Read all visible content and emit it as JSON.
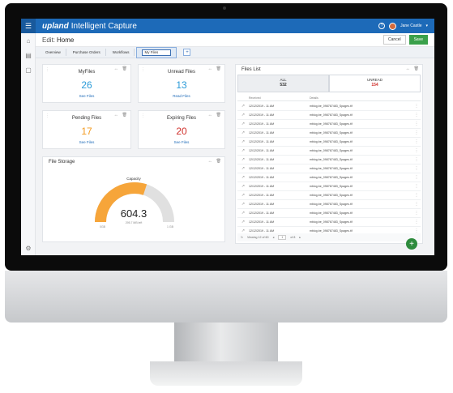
{
  "app": {
    "brand": "upland",
    "product": "Intelligent Capture",
    "help_icon": "help-circle-icon",
    "user_name": "Jane Castle",
    "accent": "#1d6ab8"
  },
  "sidebar": {
    "items": [
      {
        "icon": "home-icon",
        "glyph": "⌂"
      },
      {
        "icon": "document-icon",
        "glyph": "▤"
      },
      {
        "icon": "clipboard-icon",
        "glyph": "▢"
      },
      {
        "icon": "settings-icon",
        "glyph": "⚙"
      }
    ]
  },
  "page": {
    "title_prefix": "Edit:",
    "title": "Home",
    "cancel_label": "Cancel",
    "save_label": "Save"
  },
  "tabs": {
    "items": [
      "Overview",
      "Purchase Orders",
      "Workflows"
    ],
    "input_value": "My Files",
    "add_label": "+"
  },
  "cards": {
    "myfiles": {
      "title": "MyFiles",
      "value": "26",
      "link": "See Files",
      "color": "#2a9bd8"
    },
    "unread": {
      "title": "Unread Files",
      "value": "13",
      "link": "Read Files",
      "color": "#2a9bd8"
    },
    "pending": {
      "title": "Pending Files",
      "value": "17",
      "link": "See Files",
      "color": "#f39a1e"
    },
    "expiring": {
      "title": "Expiring Files",
      "value": "20",
      "link": "See Files",
      "color": "#d0302b"
    }
  },
  "storage": {
    "title": "File Storage",
    "caption": "Capacity",
    "value": "604.3",
    "sub": "295.7 MB left",
    "min": "0GB",
    "max": "1 GB",
    "fill_fraction": 0.6,
    "fill_color": "#f6a53a",
    "track_color": "#e0e0e0"
  },
  "files_list": {
    "title": "Files List",
    "tab_all_label": "ALL",
    "tab_all_count": "532",
    "tab_unread_label": "UNREAD",
    "tab_unread_count": "154",
    "col_received": "Received",
    "col_details": "Details",
    "rows": [
      {
        "date": "12/12/2019 - 11 AM",
        "details": "mblog.be_098767483_Spages.tif"
      },
      {
        "date": "12/12/2019 - 11 AM",
        "details": "mblog.be_098767483_Spages.tif"
      },
      {
        "date": "12/12/2019 - 11 AM",
        "details": "mblog.be_098767483_Spages.tif"
      },
      {
        "date": "12/12/2019 - 11 AM",
        "details": "mblog.be_098767483_Spages.tif"
      },
      {
        "date": "12/12/2019 - 11 AM",
        "details": "mblog.be_098767483_Spages.tif"
      },
      {
        "date": "12/12/2019 - 11 AM",
        "details": "mblog.be_098767483_Spages.tif"
      },
      {
        "date": "12/12/2019 - 11 AM",
        "details": "mblog.be_098767483_Spages.tif"
      },
      {
        "date": "12/12/2019 - 11 AM",
        "details": "mblog.be_098767483_Spages.tif"
      },
      {
        "date": "12/12/2019 - 11 AM",
        "details": "mblog.be_098767483_Spages.tif"
      },
      {
        "date": "12/12/2019 - 11 AM",
        "details": "mblog.be_098767483_Spages.tif"
      },
      {
        "date": "12/12/2019 - 11 AM",
        "details": "mblog.be_098767483_Spages.tif"
      },
      {
        "date": "12/12/2019 - 11 AM",
        "details": "mblog.be_098767483_Spages.tif"
      },
      {
        "date": "12/12/2019 - 11 AM",
        "details": "mblog.be_098767483_Spages.tif"
      },
      {
        "date": "12/12/2019 - 11 AM",
        "details": "mblog.be_098767483_Spages.tif"
      },
      {
        "date": "12/12/2019 - 11 AM",
        "details": "mblog.be_098767483_Spages.tif"
      }
    ],
    "footer_text": "Viewing 12 of 60",
    "page_number": "1",
    "page_of": "of 8",
    "add_label": "+"
  }
}
